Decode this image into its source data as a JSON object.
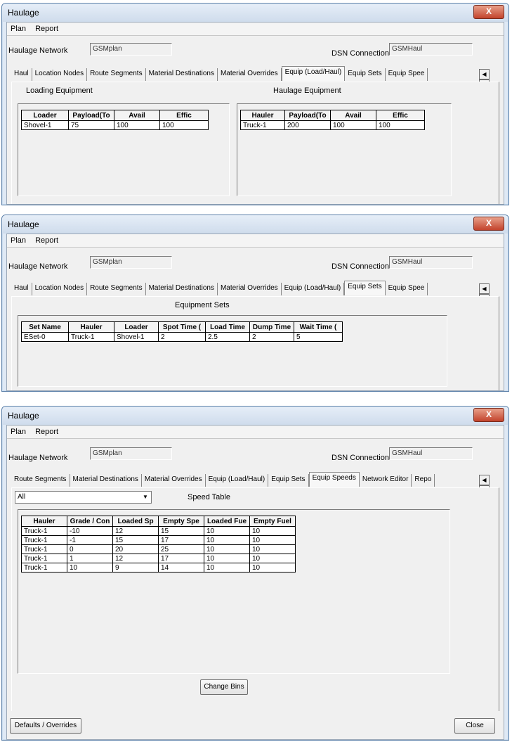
{
  "title": "Haulage",
  "close_glyph": "X",
  "menu": [
    "Plan",
    "Report"
  ],
  "network_label": "Haulage Network",
  "network_value": "GSMplan",
  "dsn_label": "DSN Connection",
  "dsn_value": "GSMHaul",
  "win1": {
    "tabs": [
      "Haul",
      "Location Nodes",
      "Route Segments",
      "Material Destinations",
      "Material Overrides",
      "Equip (Load/Haul)",
      "Equip Sets",
      "Equip Spee"
    ],
    "active_tab": "Equip (Load/Haul)",
    "loading_title": "Loading Equipment",
    "hauling_title": "Haulage Equipment",
    "loader_headers": [
      "Loader",
      "Payload(To",
      "Avail",
      "Effic"
    ],
    "loader_rows": [
      [
        "Shovel-1",
        "75",
        "100",
        "100"
      ]
    ],
    "hauler_headers": [
      "Hauler",
      "Payload(To",
      "Avail",
      "Effic"
    ],
    "hauler_rows": [
      [
        "Truck-1",
        "200",
        "100",
        "100"
      ]
    ]
  },
  "win2": {
    "tabs": [
      "Haul",
      "Location Nodes",
      "Route Segments",
      "Material Destinations",
      "Material Overrides",
      "Equip (Load/Haul)",
      "Equip Sets",
      "Equip Spee"
    ],
    "active_tab": "Equip Sets",
    "panel_title": "Equipment Sets",
    "headers": [
      "Set Name",
      "Hauler",
      "Loader",
      "Spot Time (",
      "Load Time",
      "Dump Time",
      "Wait Time ("
    ],
    "rows": [
      [
        "ESet-0",
        "Truck-1",
        "Shovel-1",
        "2",
        "2.5",
        "2",
        "5"
      ]
    ]
  },
  "win3": {
    "tabs": [
      "Route Segments",
      "Material Destinations",
      "Material Overrides",
      "Equip (Load/Haul)",
      "Equip Sets",
      "Equip Speeds",
      "Network Editor",
      "Repo"
    ],
    "active_tab": "Equip Speeds",
    "filter_value": "All",
    "panel_title": "Speed Table",
    "headers": [
      "Hauler",
      "Grade / Con",
      "Loaded Sp",
      "Empty Spe",
      "Loaded Fue",
      "Empty Fuel"
    ],
    "rows": [
      [
        "Truck-1",
        "-10",
        "12",
        "15",
        "10",
        "10"
      ],
      [
        "Truck-1",
        "-1",
        "15",
        "17",
        "10",
        "10"
      ],
      [
        "Truck-1",
        "0",
        "20",
        "25",
        "10",
        "10"
      ],
      [
        "Truck-1",
        "1",
        "12",
        "17",
        "10",
        "10"
      ],
      [
        "Truck-1",
        "10",
        "9",
        "14",
        "10",
        "10"
      ]
    ],
    "change_bins": "Change Bins",
    "defaults_button": "Defaults / Overrides",
    "close_button": "Close"
  }
}
